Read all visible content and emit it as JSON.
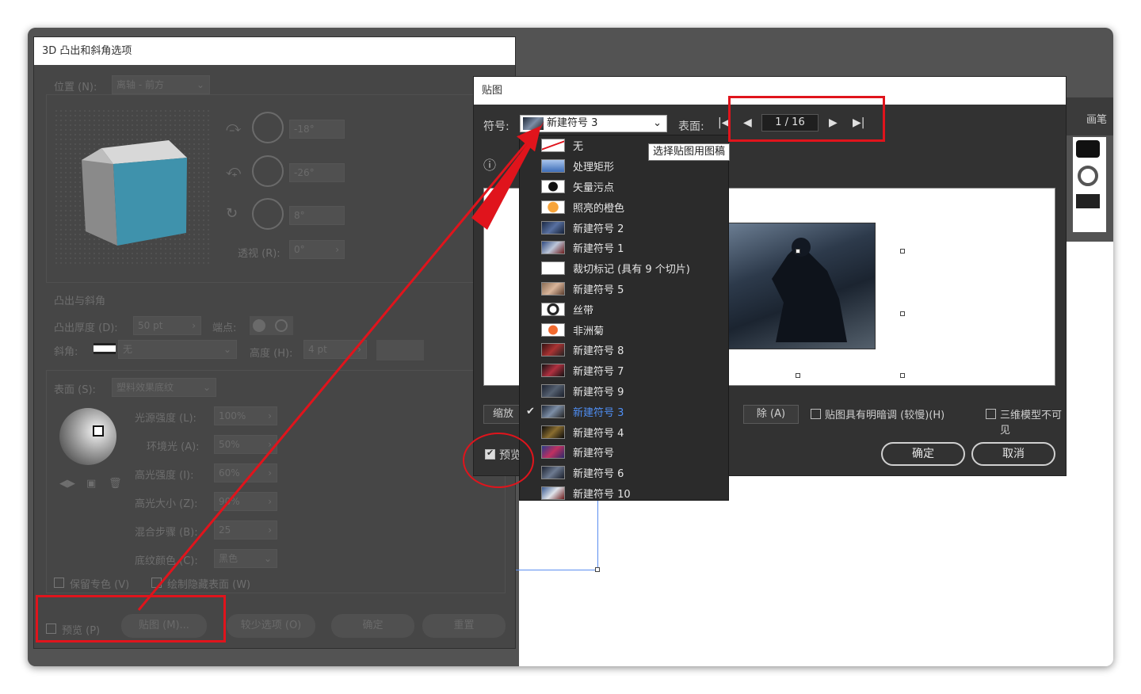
{
  "dialog3d": {
    "title": "3D 凸出和斜角选项",
    "position_label": "位置 (N):",
    "position_value": "离轴 - 前方",
    "rot_x": "-18°",
    "rot_y": "-26°",
    "rot_z": "8°",
    "perspective_label": "透视 (R):",
    "perspective_value": "0°",
    "extrude_section": "凸出与斜角",
    "extrude_depth_label": "凸出厚度 (D):",
    "extrude_depth_value": "50 pt",
    "cap_label": "端点:",
    "bevel_label": "斜角:",
    "bevel_value": "无",
    "height_label": "高度 (H):",
    "height_value": "4 pt",
    "surface_label": "表面 (S):",
    "surface_value": "塑料效果底纹",
    "light_intensity_label": "光源强度 (L):",
    "light_intensity_value": "100%",
    "ambient_label": "环境光 (A):",
    "ambient_value": "50%",
    "highlight_intensity_label": "高光强度 (I):",
    "highlight_intensity_value": "60%",
    "highlight_size_label": "高光大小 (Z):",
    "highlight_size_value": "90%",
    "blend_steps_label": "混合步骤 (B):",
    "blend_steps_value": "25",
    "shading_color_label": "底纹颜色 (C):",
    "shading_color_value": "黑色",
    "preserve_spot_label": "保留专色 (V)",
    "draw_hidden_label": "绘制隐藏表面 (W)",
    "preview_label": "预览 (P)",
    "map_art_button": "贴图 (M)...",
    "fewer_options_button": "较少选项 (O)",
    "ok_button": "确定",
    "reset_button": "重置"
  },
  "map_art": {
    "title": "贴图",
    "symbol_label": "符号:",
    "symbol_value": "新建符号 3",
    "surface_label": "表面:",
    "page_value": "1 / 16",
    "tooltip": "选择贴图用图稿",
    "scale_button": "缩放",
    "clear_button": "除 (A)",
    "shade_artwork_label": "贴图具有明暗调 (较慢)(H)",
    "invisible_geometry_label": "三维模型不可见",
    "preview_label": "预览",
    "ok_button": "确定",
    "cancel_button": "取消"
  },
  "symbol_list": [
    {
      "label": "无"
    },
    {
      "label": "处理矩形"
    },
    {
      "label": "矢量污点"
    },
    {
      "label": "照亮的橙色"
    },
    {
      "label": "新建符号 2"
    },
    {
      "label": "新建符号 1"
    },
    {
      "label": "裁切标记 (具有 9 个切片)"
    },
    {
      "label": "新建符号 5"
    },
    {
      "label": "丝带"
    },
    {
      "label": "非洲菊"
    },
    {
      "label": "新建符号 8"
    },
    {
      "label": "新建符号 7"
    },
    {
      "label": "新建符号 9"
    },
    {
      "label": "新建符号 3"
    },
    {
      "label": "新建符号 4"
    },
    {
      "label": "新建符号"
    },
    {
      "label": "新建符号 6"
    },
    {
      "label": "新建符号 10"
    }
  ],
  "side_panel": {
    "tab": "画笔"
  }
}
